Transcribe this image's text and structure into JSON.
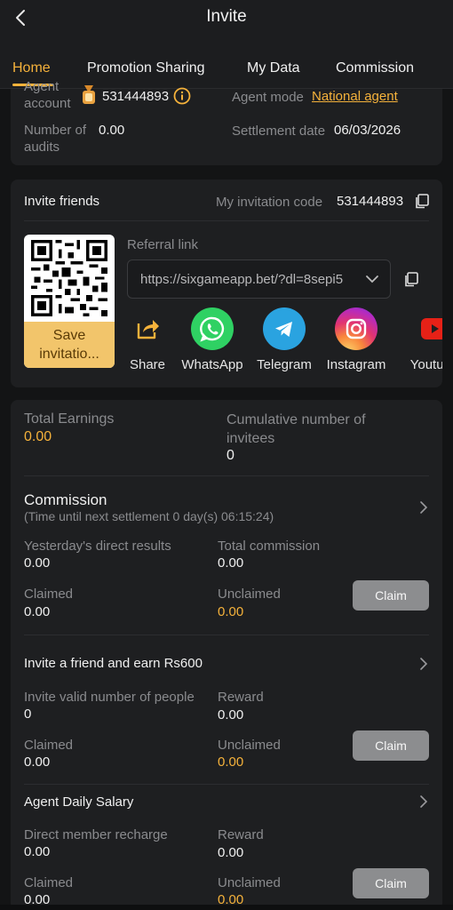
{
  "header": {
    "title": "Invite",
    "back_icon": "chevron-left-icon"
  },
  "tabs": [
    {
      "label": "Home",
      "active": true
    },
    {
      "label": "Promotion Sharing",
      "active": false
    },
    {
      "label": "My Data",
      "active": false
    },
    {
      "label": "Commission",
      "active": false
    }
  ],
  "agent": {
    "account_label": "Agent account",
    "account_value": "531444893",
    "mode_label": "Agent mode",
    "mode_value": "National agent",
    "audits_label": "Number of audits",
    "audits_value": "0.00",
    "settlement_label": "Settlement date",
    "settlement_value": "06/03/2026"
  },
  "invite": {
    "title": "Invite friends",
    "code_label": "My invitation code",
    "code_value": "531444893",
    "save_label": "Save invitatio...",
    "referral_label": "Referral link",
    "referral_url": "https://sixgameapp.bet/?dl=8sepi5",
    "share_items": [
      {
        "label": "Share",
        "icon": "share-icon"
      },
      {
        "label": "WhatsApp",
        "icon": "whatsapp-icon"
      },
      {
        "label": "Telegram",
        "icon": "telegram-icon"
      },
      {
        "label": "Instagram",
        "icon": "instagram-icon"
      },
      {
        "label": "Youtube",
        "icon": "youtube-icon"
      }
    ]
  },
  "stats": {
    "total_earnings_label": "Total Earnings",
    "total_earnings_value": "0.00",
    "invitees_label": "Cumulative number of invitees",
    "invitees_value": "0"
  },
  "commission": {
    "title": "Commission",
    "subtitle": "(Time until next settlement 0 day(s) 06:15:24)",
    "yesterday_label": "Yesterday's direct results",
    "yesterday_value": "0.00",
    "total_label": "Total commission",
    "total_value": "0.00",
    "claimed_label": "Claimed",
    "claimed_value": "0.00",
    "unclaimed_label": "Unclaimed",
    "unclaimed_value": "0.00",
    "claim_button": "Claim"
  },
  "invite_reward": {
    "title": "Invite a friend and earn Rs600",
    "valid_label": "Invite valid number of people",
    "valid_value": "0",
    "reward_label": "Reward",
    "reward_value": "0.00",
    "claimed_label": "Claimed",
    "claimed_value": "0.00",
    "unclaimed_label": "Unclaimed",
    "unclaimed_value": "0.00",
    "claim_button": "Claim"
  },
  "salary": {
    "title": "Agent Daily Salary",
    "recharge_label": "Direct member recharge",
    "recharge_value": "0.00",
    "reward_label": "Reward",
    "reward_value": "0.00",
    "claimed_label": "Claimed",
    "claimed_value": "0.00",
    "unclaimed_label": "Unclaimed",
    "unclaimed_value": "0.00",
    "claim_button": "Claim"
  },
  "colors": {
    "accent": "#f5b23b",
    "background": "#131415",
    "card": "#1e1f21"
  }
}
